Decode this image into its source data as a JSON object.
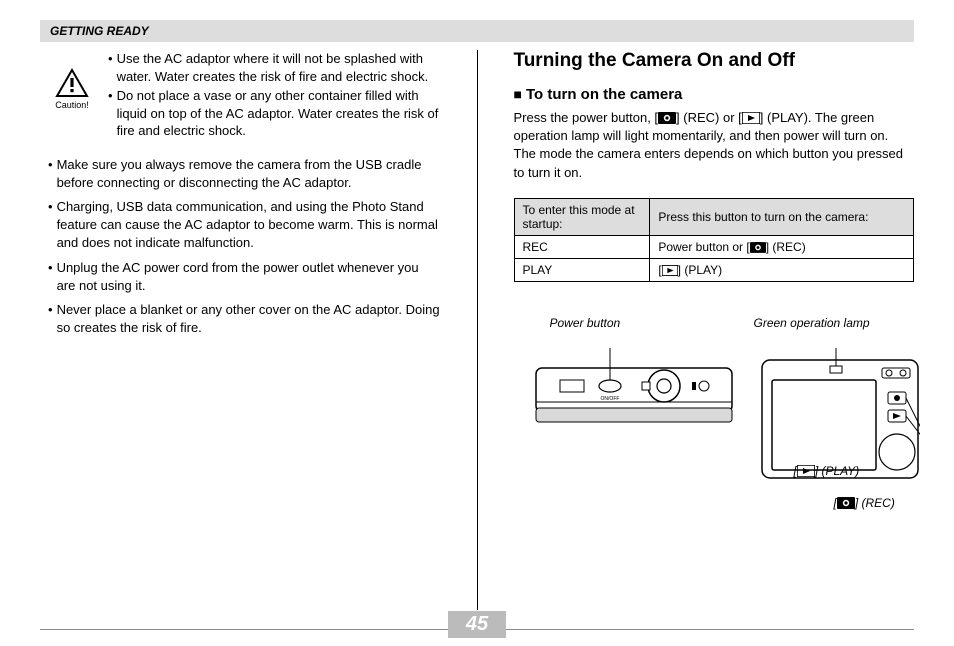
{
  "header": {
    "section": "GETTING READY"
  },
  "left": {
    "caution_label": "Caution!",
    "caution_bullets": [
      "Use the AC adaptor where it will not be splashed with water. Water creates the risk of fire and electric shock.",
      "Do not place a vase or any other container filled with liquid on top of the AC adaptor. Water creates the risk of fire and electric shock."
    ],
    "bullets": [
      "Make sure you always remove the camera from the USB cradle before connecting or disconnecting the AC adaptor.",
      "Charging, USB data communication, and using the Photo Stand feature can cause the AC adaptor to become warm. This is normal and does not indicate malfunction.",
      "Unplug the AC power cord from the power outlet whenever you are not using it.",
      "Never place a blanket or any other cover on the AC adaptor. Doing so creates the risk of fire."
    ]
  },
  "right": {
    "title": "Turning the Camera On and Off",
    "subtitle": "To turn on the camera",
    "para_pre": "Press the power button, [",
    "para_mid1": "] (REC) or [",
    "para_mid2": "] (PLAY). The green operation lamp will light momentarily, and then power will turn on. The mode the camera enters depends on which button you pressed to turn it on.",
    "table": {
      "head_left": "To enter this mode at startup:",
      "head_right": "Press this button to turn on the camera:",
      "rows": [
        {
          "mode": "REC",
          "btn_pre": "Power button or [",
          "btn_post": "] (REC)",
          "icon": "camera"
        },
        {
          "mode": "PLAY",
          "btn_pre": "[",
          "btn_post": "] (PLAY)",
          "icon": "play"
        }
      ]
    },
    "diagram": {
      "power_button": "Power button",
      "green_lamp": "Green operation lamp",
      "on_off": "ON/OFF",
      "play_label_pre": "[",
      "play_label_post": "] (PLAY)",
      "rec_label_pre": "[",
      "rec_label_post": "] (REC)"
    }
  },
  "page_number": "45"
}
